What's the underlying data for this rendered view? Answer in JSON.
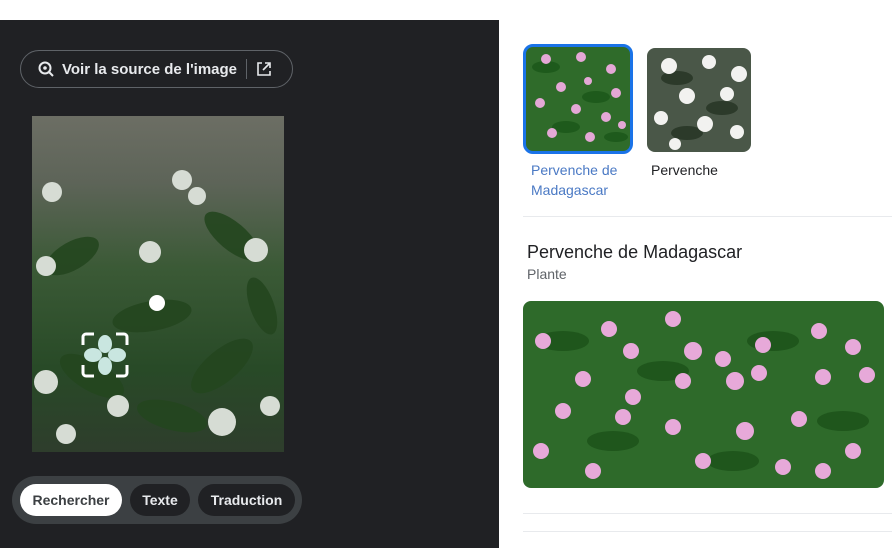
{
  "source_button": {
    "label": "Voir la source de l'image"
  },
  "tabs": [
    {
      "label": "Rechercher",
      "active": true
    },
    {
      "label": "Texte",
      "active": false
    },
    {
      "label": "Traduction",
      "active": false
    }
  ],
  "results": {
    "thumbnails": [
      {
        "label": "Pervenche de Madagascar",
        "selected": true
      },
      {
        "label": "Pervenche",
        "selected": false
      }
    ],
    "entity": {
      "title": "Pervenche de Madagascar",
      "subtitle": "Plante"
    }
  },
  "colors": {
    "panel_dark": "#202124",
    "accent_blue": "#1a73e8",
    "link_blue": "#4a79c4"
  },
  "icons": [
    "lens-icon",
    "open-in-new-icon",
    "focus-target-icon"
  ]
}
